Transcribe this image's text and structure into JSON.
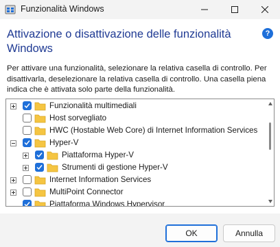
{
  "window": {
    "title": "Funzionalità Windows",
    "minimize_icon": "minimize-icon",
    "maximize_icon": "maximize-icon",
    "close_icon": "close-icon"
  },
  "header": {
    "title": "Attivazione o disattivazione delle funzionalità Windows",
    "help_label": "?"
  },
  "description": "Per attivare una funzionalità, selezionare la relativa casella di controllo. Per disattivarla, deselezionare la relativa casella di controllo. Una casella piena indica che è attivata solo parte della funzionalità.",
  "features": [
    {
      "label": "Funzionalità multimediali",
      "state": "checked",
      "expander": "plus",
      "level": 0
    },
    {
      "label": "Host sorvegliato",
      "state": "unchecked",
      "expander": "none",
      "level": 0
    },
    {
      "label": "HWC (Hostable Web Core) di Internet Information Services",
      "state": "unchecked",
      "expander": "none",
      "level": 0
    },
    {
      "label": "Hyper-V",
      "state": "checked",
      "expander": "minus",
      "level": 0
    },
    {
      "label": "Piattaforma Hyper-V",
      "state": "checked",
      "expander": "plus",
      "level": 1
    },
    {
      "label": "Strumenti di gestione Hyper-V",
      "state": "checked",
      "expander": "plus",
      "level": 1
    },
    {
      "label": "Internet Information Services",
      "state": "unchecked",
      "expander": "plus",
      "level": 0
    },
    {
      "label": "MultiPoint Connector",
      "state": "unchecked",
      "expander": "plus",
      "level": 0
    },
    {
      "label": "Piattaforma Windows Hypervisor",
      "state": "checked",
      "expander": "none",
      "level": 0
    }
  ],
  "buttons": {
    "ok": "OK",
    "cancel": "Annulla"
  },
  "colors": {
    "accent": "#1e6fd9",
    "heading": "#1f3a93",
    "folder": "#f5c542"
  }
}
